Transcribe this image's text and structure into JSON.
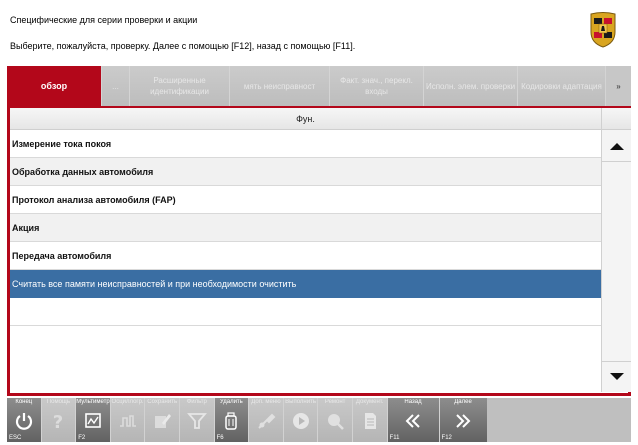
{
  "header": {
    "title": "Специфические для серии проверки и акции",
    "instruction": "Выберите, пожалуйста, проверку. Далее с помощью [F12], назад с помощью [F11]."
  },
  "tabs": [
    {
      "label": "обзор",
      "active": true
    },
    {
      "label": "...",
      "active": false
    },
    {
      "label": "Расширенные идентификации",
      "active": false
    },
    {
      "label": "мять неисправност",
      "active": false
    },
    {
      "label": "Факт. знач., перекл. входы",
      "active": false
    },
    {
      "label": "Исполн. элем. проверки",
      "active": false
    },
    {
      "label": "Кодировки адаптация",
      "active": false
    },
    {
      "label": "»",
      "active": false
    }
  ],
  "table": {
    "column_header": "Фун.",
    "rows": [
      "Измерение тока покоя",
      "Обработка данных автомобиля",
      "Протокол анализа автомобиля (FAP)",
      "Акция",
      "Передача автомобиля",
      "Считать все памяти неисправностей и при необходимости очистить"
    ],
    "selected_index": 5
  },
  "toolbar": {
    "buttons": [
      {
        "label": "Конец",
        "key": "ESC",
        "icon": "power-icon",
        "enabled": true
      },
      {
        "label": "Помощь",
        "key": "",
        "icon": "help-icon",
        "enabled": false
      },
      {
        "label": "Мультиметр",
        "key": "F2",
        "icon": "multimeter-icon",
        "enabled": true
      },
      {
        "label": "Осциллогр.",
        "key": "",
        "icon": "oscilloscope-icon",
        "enabled": false
      },
      {
        "label": "Сохранить",
        "key": "",
        "icon": "edit-icon",
        "enabled": false
      },
      {
        "label": "Фильтр",
        "key": "",
        "icon": "filter-icon",
        "enabled": false
      },
      {
        "label": "Удалить",
        "key": "F6",
        "icon": "delete-icon",
        "enabled": true
      },
      {
        "label": "Доп. меню",
        "key": "",
        "icon": "tools-icon",
        "enabled": false
      },
      {
        "label": "Выполнить",
        "key": "",
        "icon": "play-icon",
        "enabled": false
      },
      {
        "label": "Ремонт",
        "key": "",
        "icon": "repair-icon",
        "enabled": false
      },
      {
        "label": "Документ.",
        "key": "",
        "icon": "document-icon",
        "enabled": false
      },
      {
        "label": "Назад",
        "key": "F11",
        "icon": "back-icon",
        "enabled": true
      },
      {
        "label": "Далее",
        "key": "F12",
        "icon": "next-icon",
        "enabled": true
      }
    ]
  },
  "colors": {
    "accent": "#b3071a",
    "selection": "#3a6ea3",
    "toolbar": "#bfbfbf"
  }
}
